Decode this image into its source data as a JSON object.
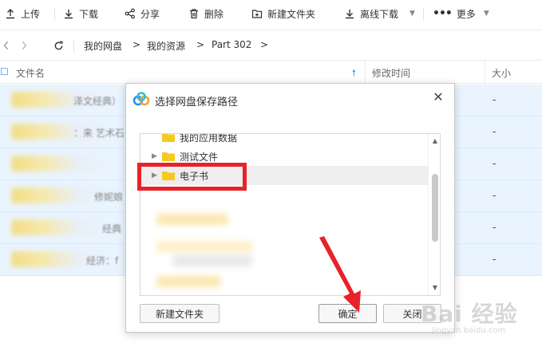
{
  "toolbar": {
    "upload": "上传",
    "download": "下载",
    "share": "分享",
    "delete": "删除",
    "new_folder": "新建文件夹",
    "offline_download": "离线下载",
    "more": "更多"
  },
  "breadcrumb": {
    "items": [
      "我的网盘",
      "我的资源",
      "Part 302"
    ],
    "separator": ">"
  },
  "table": {
    "columns": {
      "name": "文件名",
      "modified": "修改时间",
      "size": "大小"
    },
    "rows": [
      {
        "name": "泽文经典）",
        "size": "-"
      },
      {
        "name": "：来 艺术石",
        "size": "-"
      },
      {
        "name": "",
        "size": "-"
      },
      {
        "name": "修妮娘",
        "size": "-"
      },
      {
        "name": "经典",
        "size": "-"
      },
      {
        "name": "经济：f",
        "size": "-"
      }
    ]
  },
  "dialog": {
    "title": "选择网盘保存路径",
    "close": "✕",
    "tree": [
      {
        "label": "我的应用数据"
      },
      {
        "label": "测试文件"
      },
      {
        "label": "电子书"
      }
    ],
    "buttons": {
      "new_folder": "新建文件夹",
      "confirm": "确定",
      "close": "关闭"
    }
  },
  "watermark": {
    "main": "Bai 经验",
    "sub": "jingyan.baidu.com"
  },
  "colors": {
    "accent": "#2a8ff7",
    "highlight_red": "#e8222a",
    "folder_yellow": "#f7c81e",
    "row_selected": "#e9f4ff"
  }
}
